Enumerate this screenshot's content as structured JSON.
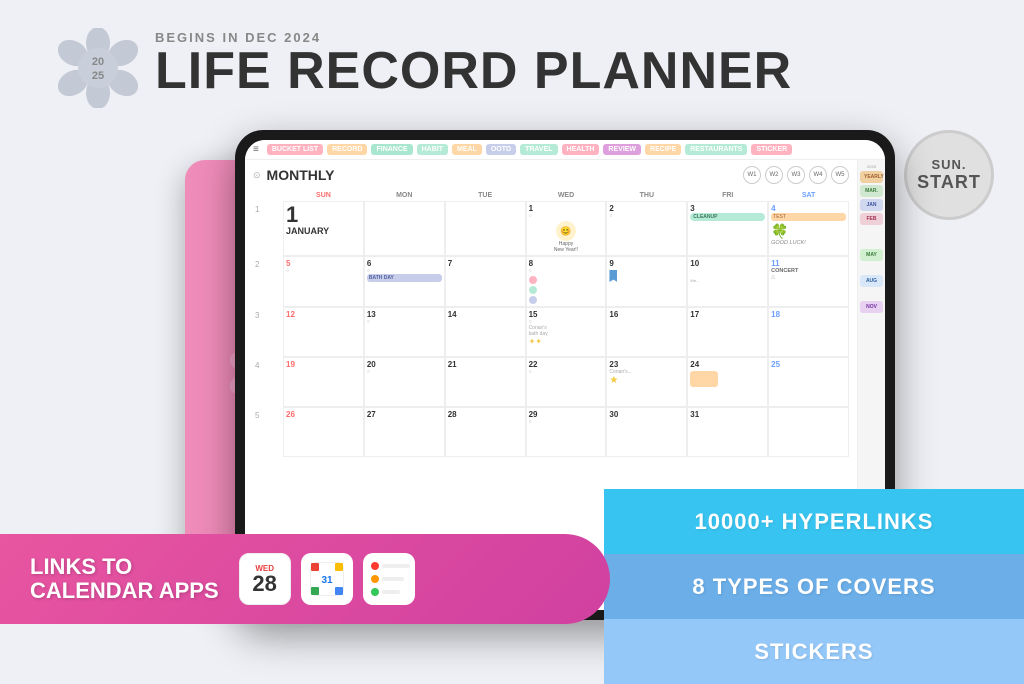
{
  "header": {
    "begins": "BEGINS IN DEC 2024",
    "title": "LIFE RECORD PLANNER",
    "sun_start": {
      "sun": "SUN.",
      "start": "START"
    }
  },
  "logo": {
    "year_top": "20",
    "year_bottom": "25"
  },
  "nav_tabs": [
    {
      "label": "BUCKET LIST",
      "class": "bucket"
    },
    {
      "label": "RECORD",
      "class": "record"
    },
    {
      "label": "FINANCE",
      "class": "finance"
    },
    {
      "label": "HABIT",
      "class": "habit"
    },
    {
      "label": "MEAL",
      "class": "meal"
    },
    {
      "label": "OOTD",
      "class": "ootd"
    },
    {
      "label": "TRAVEL",
      "class": "travel"
    },
    {
      "label": "HEALTH",
      "class": "health"
    },
    {
      "label": "REVIEW",
      "class": "review"
    },
    {
      "label": "RECIPE",
      "class": "recipe"
    },
    {
      "label": "RESTAURANTS",
      "class": "restaurants"
    },
    {
      "label": "STICKER",
      "class": "sticker"
    }
  ],
  "calendar": {
    "title": "MONTHLY",
    "week_badges": [
      "W1",
      "W2",
      "W3",
      "W4",
      "W5"
    ],
    "day_headers": [
      "",
      "SUN",
      "MON",
      "TUE",
      "WED",
      "THU",
      "FRI",
      "SAT"
    ],
    "month_label": "JANUARY",
    "row_number_1": "1",
    "big_number": "1"
  },
  "side_tabs": [
    "2025",
    "YEARLY",
    "MAR.",
    "JAN",
    "FEB",
    "MAY",
    "AUG",
    "NOV"
  ],
  "bottom_banner": {
    "links_text": "LINKS TO\nCALENDAR APPS",
    "apps": [
      {
        "name": "Date App",
        "day_name": "WED",
        "day_num": "28"
      },
      {
        "name": "Google Calendar"
      },
      {
        "name": "Reminders"
      }
    ]
  },
  "features": {
    "hyperlinks": "10000+ HYPERLINKS",
    "covers": "8 TYPES OF COVERS",
    "stickers": "STICKERS"
  },
  "colors": {
    "accent_pink": "#e855a0",
    "banner_blue1": "#38c4f0",
    "banner_blue2": "#6baee8",
    "banner_blue3": "#94c8f8",
    "tablet_pink": "#f08cba"
  }
}
